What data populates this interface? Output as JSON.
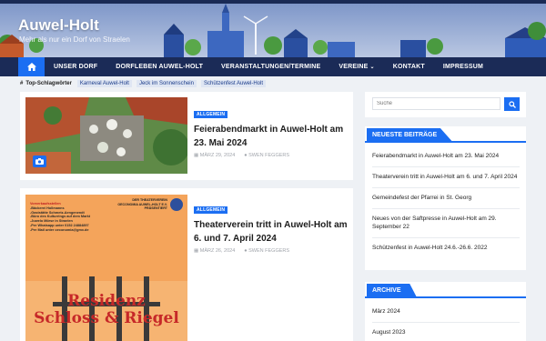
{
  "site": {
    "title": "Auwel-Holt",
    "tagline": "Mehr als nur ein Dorf von Straelen"
  },
  "nav": {
    "home_icon": "home-icon",
    "items": [
      "UNSER DORF",
      "DORFLEBEN AUWEL-HOLT",
      "VERANSTALTUNGEN/TERMINE",
      "VEREINE",
      "KONTAKT",
      "IMPRESSUM"
    ],
    "vereine_caret": "⌄"
  },
  "tags": {
    "title": "Top-Schlagwörter",
    "items": [
      "Karneval Auwel-Holt",
      "Jeck im Sonnenschein",
      "Schützenfest Auwel-Holt"
    ]
  },
  "posts": [
    {
      "category": "ALLGEMEIN",
      "title": "Feierabendmarkt in Auwel-Holt am 23. Mai 2024",
      "date": "MÄRZ 29, 2024",
      "author": "SWEN FEGGERS"
    },
    {
      "category": "ALLGEMEIN",
      "title": "Theaterverein tritt in Auwel-Holt am 6. und 7. April 2024",
      "date": "MÄRZ 26, 2024",
      "author": "SWEN FEGGERS",
      "poster": {
        "header_lines": [
          "DER THEATERVEREIN",
          "OECONOMIA AUWEL-HOLT E.V.",
          "PRÄSENTIERT"
        ],
        "presale_title": "Vorverkaufsstellen",
        "presale_lines": [
          "-Bäckerei Hollmanns",
          "-Gaststätte Schmetz-Aengenendt",
          "-Büro des Kulturrings auf dem Markt",
          "-Juwelo Mörse in Straelen",
          "-Per Whatsapp unter 0152 24884897",
          "-Per Mail unter oeconomia@gmx.de"
        ],
        "play_line1": "Residenz",
        "play_line2": "Schloss & Riegel"
      }
    }
  ],
  "search": {
    "placeholder": "Suche"
  },
  "widgets": {
    "recent": {
      "title": "NEUESTE BEITRÄGE",
      "items": [
        "Feierabendmarkt in Auwel-Holt am 23. Mai 2024",
        "Theaterverein tritt in Auwel-Holt am 6. und 7. April 2024",
        "Gemeindefest der Pfarrei in St. Georg",
        "Neues von der Saftpresse in Auwel-Holt am 29. September 22",
        "Schützenfest in Auwel-Holt 24.6.-26.6. 2022"
      ]
    },
    "archive": {
      "title": "ARCHIVE",
      "items": [
        "März 2024",
        "August 2023"
      ]
    }
  },
  "colors": {
    "accent": "#1b6ef2",
    "nav": "#1b2b57",
    "header": "#2f55a4"
  }
}
